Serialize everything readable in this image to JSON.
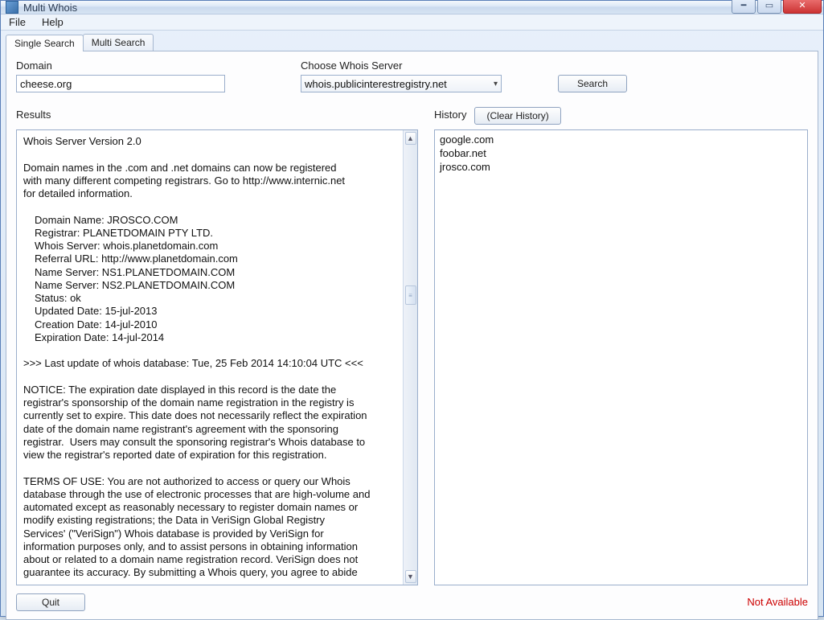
{
  "window": {
    "title": "Multi Whois"
  },
  "menu": {
    "file": "File",
    "help": "Help"
  },
  "tabs": {
    "single": "Single Search",
    "multi": "Multi Search"
  },
  "form": {
    "domain_label": "Domain",
    "domain_value": "cheese.org",
    "server_label": "Choose Whois Server",
    "server_value": "whois.publicinterestregistry.net",
    "search_btn": "Search"
  },
  "section": {
    "results_label": "Results",
    "history_label": "History",
    "clear_history_btn": "(Clear History)"
  },
  "results": {
    "l0": "Whois Server Version 2.0",
    "l1": "Domain names in the .com and .net domains can now be registered",
    "l2": "with many different competing registrars. Go to http://www.internic.net",
    "l3": "for detailed information.",
    "d0": "Domain Name: JROSCO.COM",
    "d1": "Registrar: PLANETDOMAIN PTY LTD.",
    "d2": "Whois Server: whois.planetdomain.com",
    "d3": "Referral URL: http://www.planetdomain.com",
    "d4": "Name Server: NS1.PLANETDOMAIN.COM",
    "d5": "Name Server: NS2.PLANETDOMAIN.COM",
    "d6": "Status: ok",
    "d7": "Updated Date: 15-jul-2013",
    "d8": "Creation Date: 14-jul-2010",
    "d9": "Expiration Date: 14-jul-2014",
    "u0": ">>> Last update of whois database: Tue, 25 Feb 2014 14:10:04 UTC <<<",
    "n0": "NOTICE: The expiration date displayed in this record is the date the",
    "n1": "registrar's sponsorship of the domain name registration in the registry is",
    "n2": "currently set to expire. This date does not necessarily reflect the expiration",
    "n3": "date of the domain name registrant's agreement with the sponsoring",
    "n4": "registrar.  Users may consult the sponsoring registrar's Whois database to",
    "n5": "view the registrar's reported date of expiration for this registration.",
    "t0": "TERMS OF USE: You are not authorized to access or query our Whois",
    "t1": "database through the use of electronic processes that are high-volume and",
    "t2": "automated except as reasonably necessary to register domain names or",
    "t3": "modify existing registrations; the Data in VeriSign Global Registry",
    "t4": "Services' (\"VeriSign\") Whois database is provided by VeriSign for",
    "t5": "information purposes only, and to assist persons in obtaining information",
    "t6": "about or related to a domain name registration record. VeriSign does not",
    "t7": "guarantee its accuracy. By submitting a Whois query, you agree to abide"
  },
  "history": {
    "i0": "google.com",
    "i1": "foobar.net",
    "i2": "jrosco.com"
  },
  "footer": {
    "quit": "Quit",
    "status": "Not Available"
  }
}
